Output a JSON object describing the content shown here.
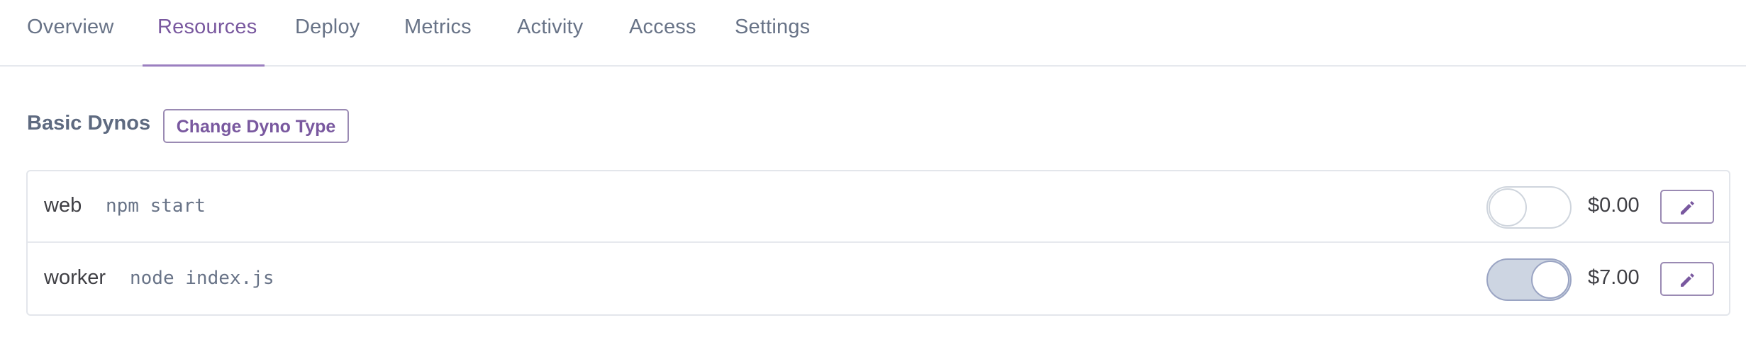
{
  "tabs": [
    {
      "label": "Overview",
      "active": false
    },
    {
      "label": "Resources",
      "active": true
    },
    {
      "label": "Deploy",
      "active": false
    },
    {
      "label": "Metrics",
      "active": false
    },
    {
      "label": "Activity",
      "active": false
    },
    {
      "label": "Access",
      "active": false
    },
    {
      "label": "Settings",
      "active": false
    }
  ],
  "section": {
    "title": "Basic Dynos",
    "change_button": "Change Dyno Type"
  },
  "dynos": [
    {
      "name": "web",
      "command": "npm start",
      "enabled": false,
      "price": "$0.00",
      "edit_icon": "pencil-icon"
    },
    {
      "name": "worker",
      "command": "node index.js",
      "enabled": true,
      "price": "$7.00",
      "edit_icon": "pencil-icon"
    }
  ],
  "colors": {
    "accent": "#79589f",
    "text": "#3f3f44",
    "muted": "#687387",
    "toggle_on": "#cdd5e2"
  }
}
